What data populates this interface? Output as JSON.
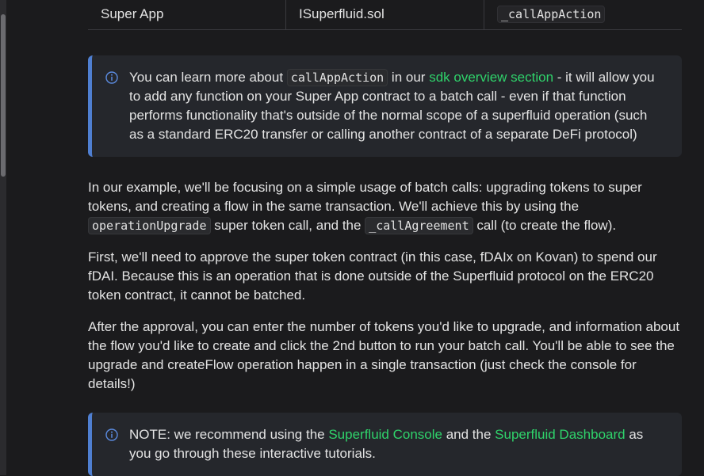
{
  "table": {
    "row": [
      "Super App",
      "ISuperfluid.sol",
      "_callAppAction"
    ]
  },
  "info_box_1": {
    "text_before_code": "You can learn more about ",
    "code": "callAppAction",
    "text_mid": " in our ",
    "link": "sdk overview section",
    "text_after": " - it will allow you to add any function on your Super App contract to a batch call - even if that function performs functionality that's outside of the normal scope of a superfluid operation (such as a standard ERC20 transfer or calling another contract of a separate DeFi protocol)"
  },
  "paragraph_1": {
    "text_1": "In our example, we'll be focusing on a simple usage of batch calls: upgrading tokens to super tokens, and creating a flow in the same transaction. We'll achieve this by using the ",
    "code_1": "operationUpgrade",
    "text_2": " super token call, and the ",
    "code_2": "_callAgreement",
    "text_3": " call (to create the flow)."
  },
  "paragraph_2": "First, we'll need to approve the super token contract (in this case, fDAIx on Kovan) to spend our fDAI. Because this is an operation that is done outside of the Superfluid protocol on the ERC20 token contract, it cannot be batched.",
  "paragraph_3": "After the approval, you can enter the number of tokens you'd like to upgrade, and information about the flow you'd like to create and click the 2nd button to run your batch call. You'll be able to see the upgrade and createFlow operation happen in a single transaction (just check the console for details!)",
  "info_box_2": {
    "text_1": "NOTE: we recommend using the ",
    "link_1": "Superfluid Console",
    "text_2": " and the ",
    "link_2": "Superfluid Dashboard",
    "text_3": " as you go through these interactive tutorials."
  },
  "colors": {
    "link": "#2fd36b",
    "admonition_border": "#4f7fd1",
    "background": "#1b1b1d"
  },
  "icons": [
    "info-icon"
  ]
}
